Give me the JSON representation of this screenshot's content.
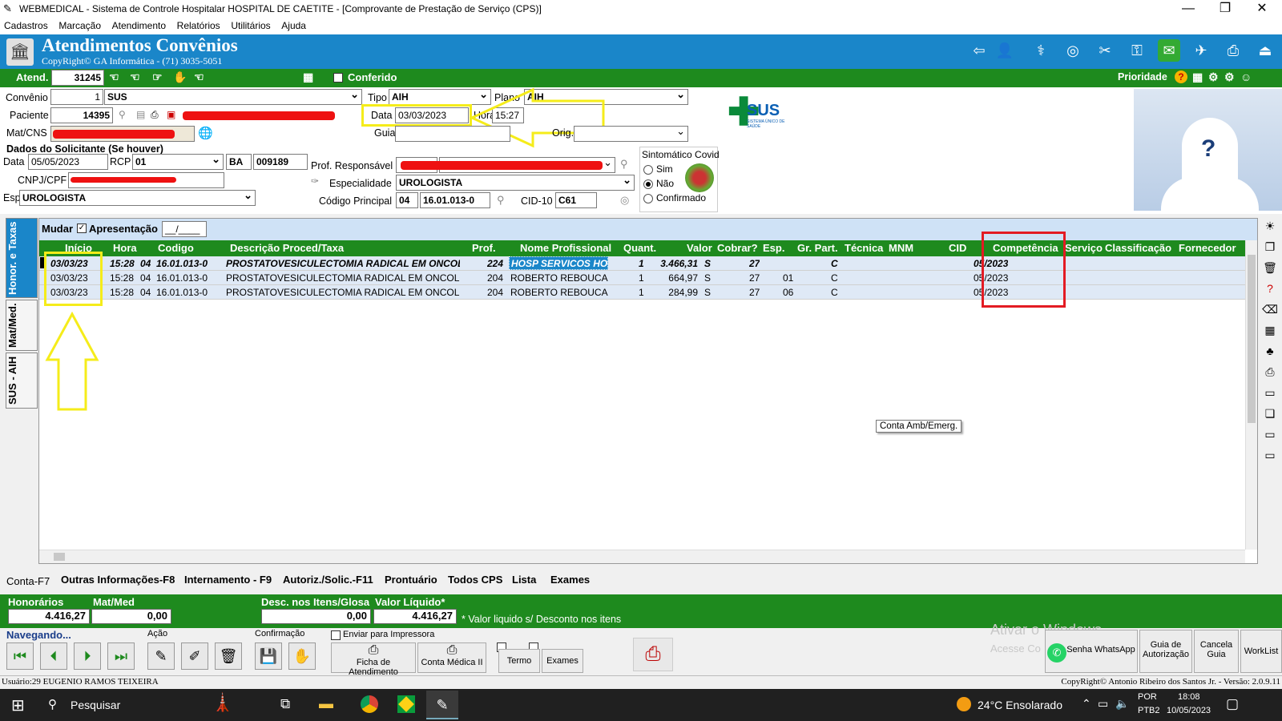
{
  "window": {
    "title": "WEBMEDICAL - Sistema de Controle Hospitalar HOSPITAL DE CAETITE - [Comprovante de Prestação de Serviço  (CPS)]",
    "minimize": "—",
    "maximize": "❐",
    "close": "✕"
  },
  "menu": [
    "Cadastros",
    "Marcação",
    "Atendimento",
    "Relatórios",
    "Utilitários",
    "Ajuda"
  ],
  "header": {
    "title": "Atendimentos Convênios",
    "copyright": "CopyRight© GA Informática - (71) 3035-5051"
  },
  "atend_bar": {
    "atend_label": "Atend.",
    "atend_value": "31245",
    "conferido_label": "Conferido",
    "prioridade_label": "Prioridade"
  },
  "form": {
    "convenio_label": "Convênio",
    "convenio_code": "1",
    "convenio_name": "SUS",
    "tipo_label": "Tipo",
    "tipo_value": "AIH",
    "plano_label": "Plano",
    "plano_value": "AIH",
    "paciente_label": "Paciente",
    "paciente_code": "14395",
    "data_label": "Data",
    "data_value": "03/03/2023",
    "hora_label": "Hora",
    "hora_value": "15:27",
    "matcns_label": "Mat/CNS",
    "guia_label": "Guia",
    "orig_label": "Orig.",
    "solicitante_title": "Dados do Solicitante (Se houver)",
    "sol_data_label": "Data",
    "sol_data_value": "05/05/2023",
    "rcp_label": "RCP",
    "rcp_value": "01",
    "uf_value": "BA",
    "crm_value": "009189",
    "cnpj_label": "CNPJ/CPF",
    "esp_label": "Esp",
    "esp_value": "UROLOGISTA",
    "prof_resp_label": "Prof. Responsável",
    "especialidade_label": "Especialidade",
    "especialidade_value": "UROLOGISTA",
    "codigo_principal_label": "Código Principal",
    "codigo_principal_group": "04",
    "codigo_principal_value": "16.01.013-0",
    "cid_label": "CID-10",
    "cid_value": "C61",
    "sintomatico_label": "Sintomático Covid",
    "sim_label": "Sim",
    "nao_label": "Não",
    "confirmado_label": "Confirmado",
    "sus_logo": "SUS",
    "sus_logo_sub": "SISTEMA ÚNICO DE SAÚDE"
  },
  "left_tabs": [
    "Honor. e Taxas",
    "Mat/Med.",
    "SUS - AIH"
  ],
  "grid": {
    "mudar_label": "Mudar",
    "apresentacao_label": "Apresentação",
    "apresentacao_value": "__/____",
    "columns": [
      "Início",
      "Hora",
      "Codigo",
      "Descrição Proced/Taxa",
      "Prof.",
      "Nome Profissional",
      "Quant.",
      "Valor",
      "Cobrar?",
      "Esp.",
      "Gr. Part.",
      "Técnica",
      "MNM",
      "CID",
      "Competência",
      "Serviço",
      "Classificação",
      "Fornecedor"
    ],
    "rows": [
      {
        "inicio": "03/03/23",
        "hora": "15:28",
        "grupo": "04",
        "codigo": "16.01.013-0",
        "descricao": "PROSTATOVESICULECTOMIA RADICAL EM ONCOL",
        "prof": "224",
        "nome": "HOSP SERVICOS HOS",
        "quant": "1",
        "valor": "3.466,31",
        "cobrar": "S",
        "esp": "27",
        "grpart": "",
        "tecnica": "C",
        "competencia": "05/2023"
      },
      {
        "inicio": "03/03/23",
        "hora": "15:28",
        "grupo": "04",
        "codigo": "16.01.013-0",
        "descricao": "PROSTATOVESICULECTOMIA RADICAL EM ONCOLO",
        "prof": "204",
        "nome": "ROBERTO REBOUCAS",
        "quant": "1",
        "valor": "664,97",
        "cobrar": "S",
        "esp": "27",
        "grpart": "01",
        "tecnica": "C",
        "competencia": "05/2023"
      },
      {
        "inicio": "03/03/23",
        "hora": "15:28",
        "grupo": "04",
        "codigo": "16.01.013-0",
        "descricao": "PROSTATOVESICULECTOMIA RADICAL EM ONCOLO",
        "prof": "204",
        "nome": "ROBERTO REBOUCAS",
        "quant": "1",
        "valor": "284,99",
        "cobrar": "S",
        "esp": "27",
        "grpart": "06",
        "tecnica": "C",
        "competencia": "05/2023"
      }
    ],
    "tooltip": "Conta Amb/Emerg."
  },
  "bottom_tabs": [
    "Conta-F7",
    "Outras Informações-F8",
    "Internamento - F9",
    "Autoriz./Solic.-F11",
    "Prontuário",
    "Todos CPS",
    "Lista",
    "Exames"
  ],
  "totals": {
    "honorarios_label": "Honorários",
    "honorarios_value": "4.416,27",
    "matmed_label": "Mat/Med",
    "matmed_value": "0,00",
    "desc_label": "Desc. nos Itens/Glosa",
    "desc_value": "0,00",
    "liquido_label": "Valor Líquido*",
    "liquido_value": "4.416,27",
    "note": "* Valor liquido s/ Desconto nos itens"
  },
  "nav": {
    "navegando_label": "Navegando...",
    "acao_label": "Ação",
    "confirmacao_label": "Confirmação",
    "enviar_label": "Enviar para Impressora",
    "ficha_label": "Ficha de Atendimento",
    "conta_medica_label": "Conta Médica II",
    "termo_label": "Termo",
    "exames_label": "Exames",
    "whatsapp_label": "Senha WhatsApp",
    "guia_aut_label": "Guia de Autorização",
    "cancela_label": "Cancela Guia",
    "worklist_label": "WorkList",
    "activate_line1": "Ativar o Windows",
    "activate_line2": "Acesse Co"
  },
  "status": {
    "user": "Usuário:29 EUGENIO RAMOS TEIXEIRA",
    "copyright": "CopyRight© Antonio Ribeiro dos Santos Jr. - Versão: 2.0.9.11"
  },
  "taskbar": {
    "search": "Pesquisar",
    "weather": "24°C  Ensolarado",
    "lang1": "POR",
    "lang2": "PTB2",
    "time": "18:08",
    "date": "10/05/2023"
  },
  "colors": {
    "header_blue": "#1a86c9",
    "green": "#1e8a1e",
    "highlight_yellow": "#f5ec1a",
    "highlight_red": "#e31b23"
  }
}
